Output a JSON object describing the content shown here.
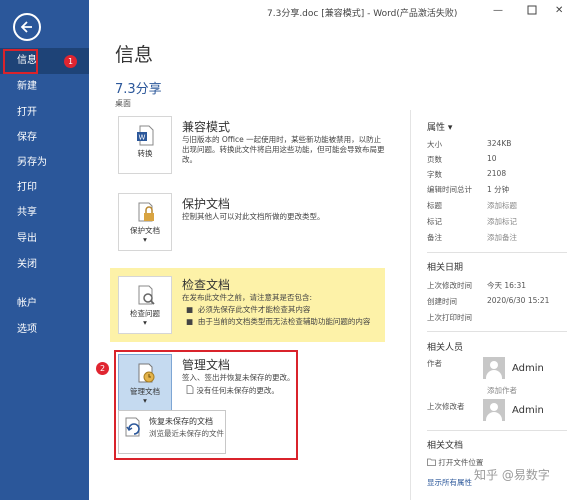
{
  "window": {
    "title": "7.3分享.doc [兼容模式] - Word(产品激活失败)",
    "min": "—",
    "close": "✕"
  },
  "sidebar": {
    "items": [
      {
        "label": "信息"
      },
      {
        "label": "新建"
      },
      {
        "label": "打开"
      },
      {
        "label": "保存"
      },
      {
        "label": "另存为"
      },
      {
        "label": "打印"
      },
      {
        "label": "共享"
      },
      {
        "label": "导出"
      },
      {
        "label": "关闭"
      },
      {
        "label": "帐户"
      },
      {
        "label": "选项"
      }
    ]
  },
  "annotations": {
    "marker1": "1",
    "marker2": "2"
  },
  "main": {
    "title": "信息",
    "doc_name": "7.3分享",
    "doc_location": "桌面",
    "compat": {
      "icon_label": "转换",
      "heading": "兼容模式",
      "desc": "与旧版本的 Office 一起使用时，某些新功能被禁用，以防止出现问题。转换此文件将启用这些功能，但可能会导致布局更改。"
    },
    "protect": {
      "icon_label": "保护文档",
      "heading": "保护文档",
      "desc": "控制其他人可以对此文档所做的更改类型。"
    },
    "inspect": {
      "icon_label": "检查问题",
      "heading": "检查文档",
      "desc": "在发布此文件之前，请注意其是否包含:",
      "bullet1": "必须先保存此文件才能检查其内容",
      "bullet2": "由于当前的文档类型而无法检查辅助功能问题的内容"
    },
    "manage": {
      "icon_label": "管理文档",
      "heading": "管理文档",
      "desc": "签入、签出并恢复未保存的更改。",
      "no_unsaved": "没有任何未保存的更改。",
      "recover_title": "恢复未保存的文档",
      "recover_desc": "浏览最近未保存的文件"
    }
  },
  "properties": {
    "title": "属性",
    "rows": [
      {
        "label": "大小",
        "value": "324KB"
      },
      {
        "label": "页数",
        "value": "10"
      },
      {
        "label": "字数",
        "value": "2108"
      },
      {
        "label": "编辑时间总计",
        "value": "1 分钟"
      },
      {
        "label": "标题",
        "value": "添加标题"
      },
      {
        "label": "标记",
        "value": "添加标记"
      },
      {
        "label": "备注",
        "value": "添加备注"
      }
    ]
  },
  "dates": {
    "title": "相关日期",
    "rows": [
      {
        "label": "上次修改时间",
        "value": "今天 16:31"
      },
      {
        "label": "创建时间",
        "value": "2020/6/30 15:21"
      },
      {
        "label": "上次打印时间",
        "value": ""
      }
    ]
  },
  "people": {
    "title": "相关人员",
    "author_label": "作者",
    "author_name": "Admin",
    "add_author": "添加作者",
    "last_modified_label": "上次修改者",
    "last_modified_name": "Admin"
  },
  "related_docs": {
    "title": "相关文档",
    "open_location": "打开文件位置",
    "show_all": "显示所有属性"
  },
  "watermark": "知乎 @易数字"
}
